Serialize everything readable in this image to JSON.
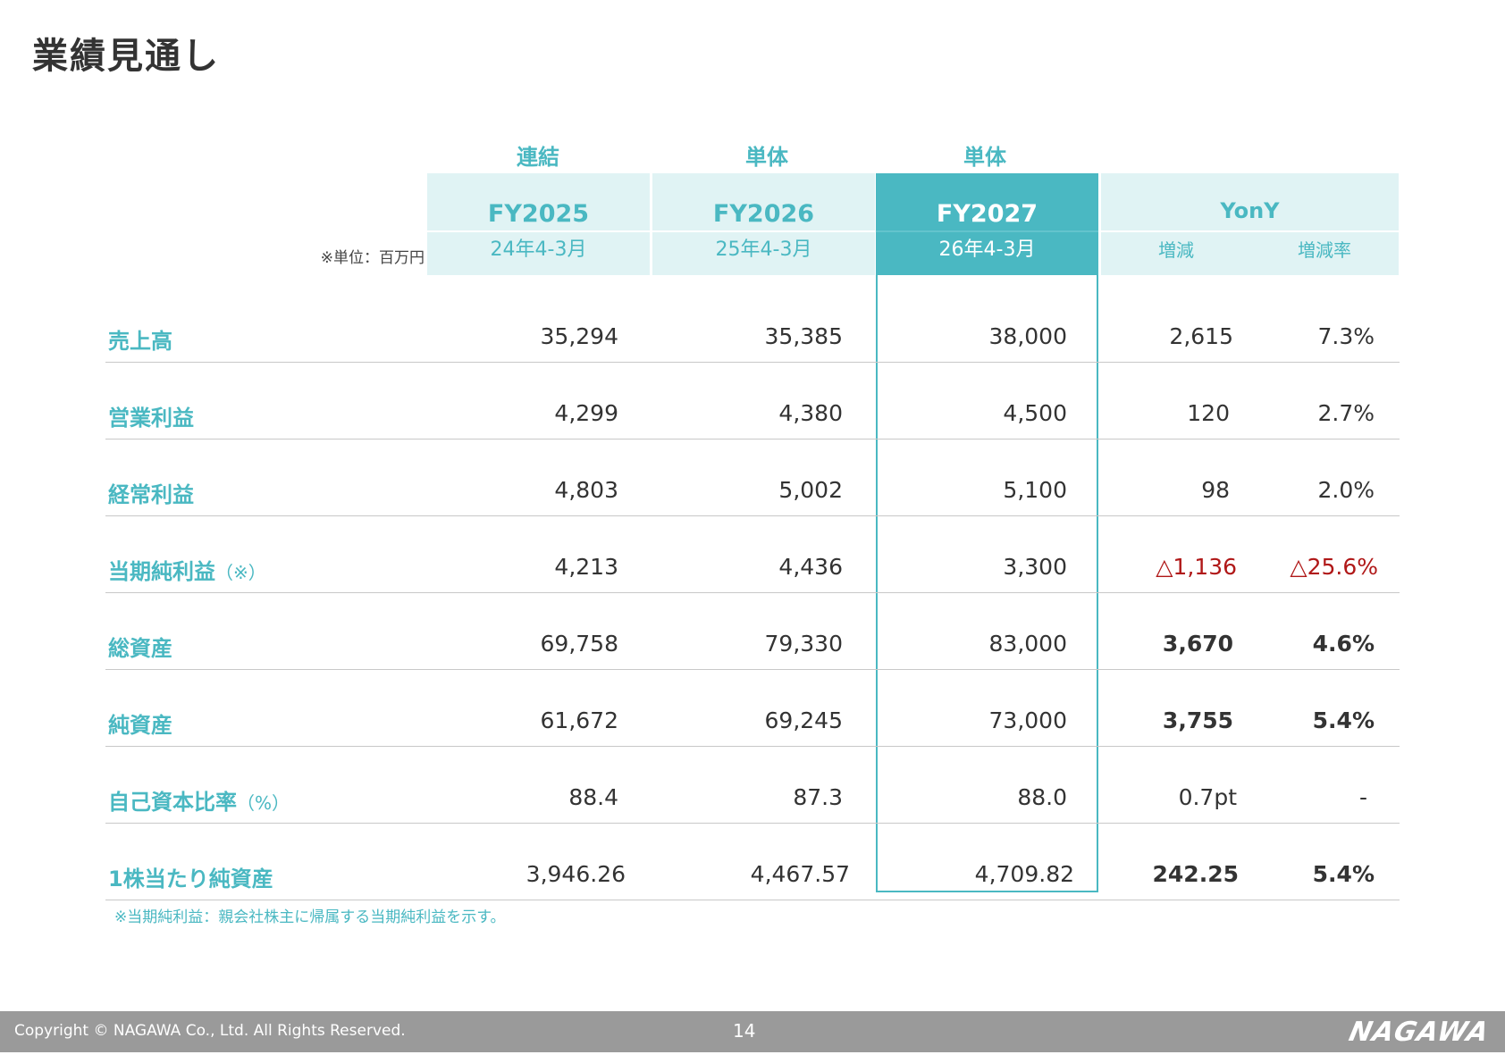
{
  "title": "業績見通し",
  "unit_note": "※単位：百万円",
  "groups": [
    "連結",
    "単体",
    "単体"
  ],
  "columns": [
    {
      "fy": "FY2025",
      "period": "24年4-3月"
    },
    {
      "fy": "FY2026",
      "period": "25年4-3月"
    },
    {
      "fy": "FY2027",
      "period": "26年4-3月"
    }
  ],
  "yony": {
    "title": "YonY",
    "sub1": "増減",
    "sub2": "増減率"
  },
  "rows": [
    {
      "label": "売上高",
      "suffix": "",
      "v1": "35,294",
      "v2": "35,385",
      "v3": "38,000",
      "d": "2,615",
      "r": "7.3%"
    },
    {
      "label": "営業利益",
      "suffix": "",
      "v1": "4,299",
      "v2": "4,380",
      "v3": "4,500",
      "d": "120",
      "r": "2.7%"
    },
    {
      "label": "経常利益",
      "suffix": "",
      "v1": "4,803",
      "v2": "5,002",
      "v3": "5,100",
      "d": "98",
      "r": "2.0%"
    },
    {
      "label": "当期純利益",
      "suffix": "（※）",
      "v1": "4,213",
      "v2": "4,436",
      "v3": "3,300",
      "d": "△1,136",
      "r": "△25.6%"
    },
    {
      "label": "総資産",
      "suffix": "",
      "v1": "69,758",
      "v2": "79,330",
      "v3": "83,000",
      "d": "3,670",
      "r": "4.6%"
    },
    {
      "label": "純資産",
      "suffix": "",
      "v1": "61,672",
      "v2": "69,245",
      "v3": "73,000",
      "d": "3,755",
      "r": "5.4%"
    },
    {
      "label": "自己資本比率",
      "suffix": "（%）",
      "v1": "88.4",
      "v2": "87.3",
      "v3": "88.0",
      "d": "0.7pt",
      "r": "-"
    },
    {
      "label": "1株当たり純資産",
      "suffix": "",
      "v1": "3,946.26",
      "v2": "4,467.57",
      "v3": "4,709.82",
      "d": "242.25",
      "r": "5.4%"
    }
  ],
  "footnote": "※当期純利益：親会社株主に帰属する当期純利益を示す。",
  "footer": {
    "copyright": "Copyright © NAGAWA Co., Ltd. All Rights Reserved.",
    "page": "14",
    "logo": "NAGAWA"
  },
  "colors": {
    "accent": "#4ab8c2",
    "header_bg": "#e0f3f4",
    "negative": "#b01818",
    "footer_bg": "#9a9a9a"
  }
}
